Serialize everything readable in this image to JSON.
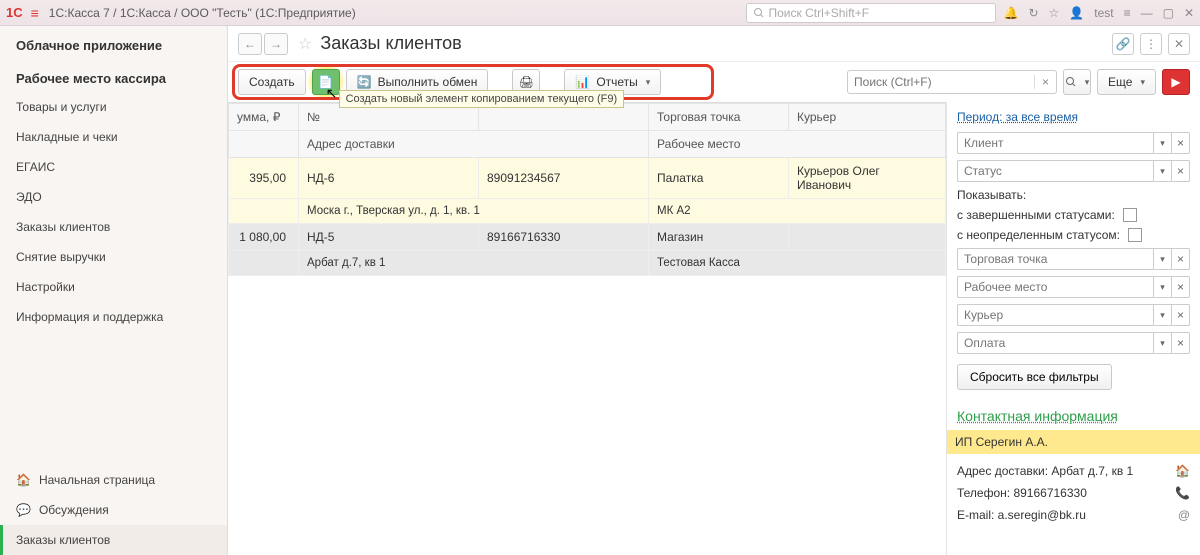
{
  "topbar": {
    "logo": "1C",
    "title": "1С:Касса 7 / 1С:Касса / ООО \"Тесть\"  (1С:Предприятие)",
    "search_placeholder": "Поиск Ctrl+Shift+F",
    "user": "test"
  },
  "sidebar": {
    "group1": "Облачное приложение",
    "group2": "Рабочее место кассира",
    "items": [
      "Товары и услуги",
      "Накладные и чеки",
      "ЕГАИС",
      "ЭДО",
      "Заказы клиентов",
      "Снятие выручки",
      "Настройки",
      "Информация и поддержка"
    ],
    "bottom": {
      "home": "Начальная страница",
      "discuss": "Обсуждения",
      "orders": "Заказы клиентов"
    }
  },
  "page": {
    "title": "Заказы клиентов"
  },
  "toolbar": {
    "create": "Создать",
    "copy_tooltip": "Создать новый элемент копированием текущего (F9)",
    "exchange": "Выполнить обмен",
    "reports": "Отчеты",
    "search_placeholder": "Поиск (Ctrl+F)",
    "more": "Еще"
  },
  "grid": {
    "columns": {
      "sum": "умма, ₽",
      "num": "№",
      "outlet": "Торговая точка",
      "courier": "Курьер",
      "addr": "Адрес доставки",
      "workplace": "Рабочее место"
    },
    "rows": [
      {
        "amount": "395,00",
        "num": "НД-6",
        "phone": "89091234567",
        "outlet": "Палатка",
        "courier": "Курьеров Олег Иванович",
        "addr": "Моска г., Тверская ул., д. 1, кв. 1",
        "workplace": "МК А2"
      },
      {
        "amount": "1 080,00",
        "num": "НД-5",
        "phone": "89166716330",
        "outlet": "Магазин",
        "courier": "",
        "addr": "Арбат д.7, кв 1",
        "workplace": "Тестовая Касса"
      }
    ]
  },
  "filters": {
    "period": "Период: за все время",
    "client_ph": "Клиент",
    "status_ph": "Статус",
    "show": "Показывать:",
    "completed": "с завершенными статусами:",
    "undefined": "с неопределенным статусом:",
    "outlet_ph": "Торговая точка",
    "workplace_ph": "Рабочее место",
    "courier_ph": "Курьер",
    "payment_ph": "Оплата",
    "reset": "Сбросить все фильтры"
  },
  "contact": {
    "title": "Контактная информация",
    "name": "ИП Серегин А.А.",
    "addr": "Адрес доставки: Арбат д.7, кв 1",
    "phone": "Телефон: 89166716330",
    "email": "E-mail: a.seregin@bk.ru"
  }
}
